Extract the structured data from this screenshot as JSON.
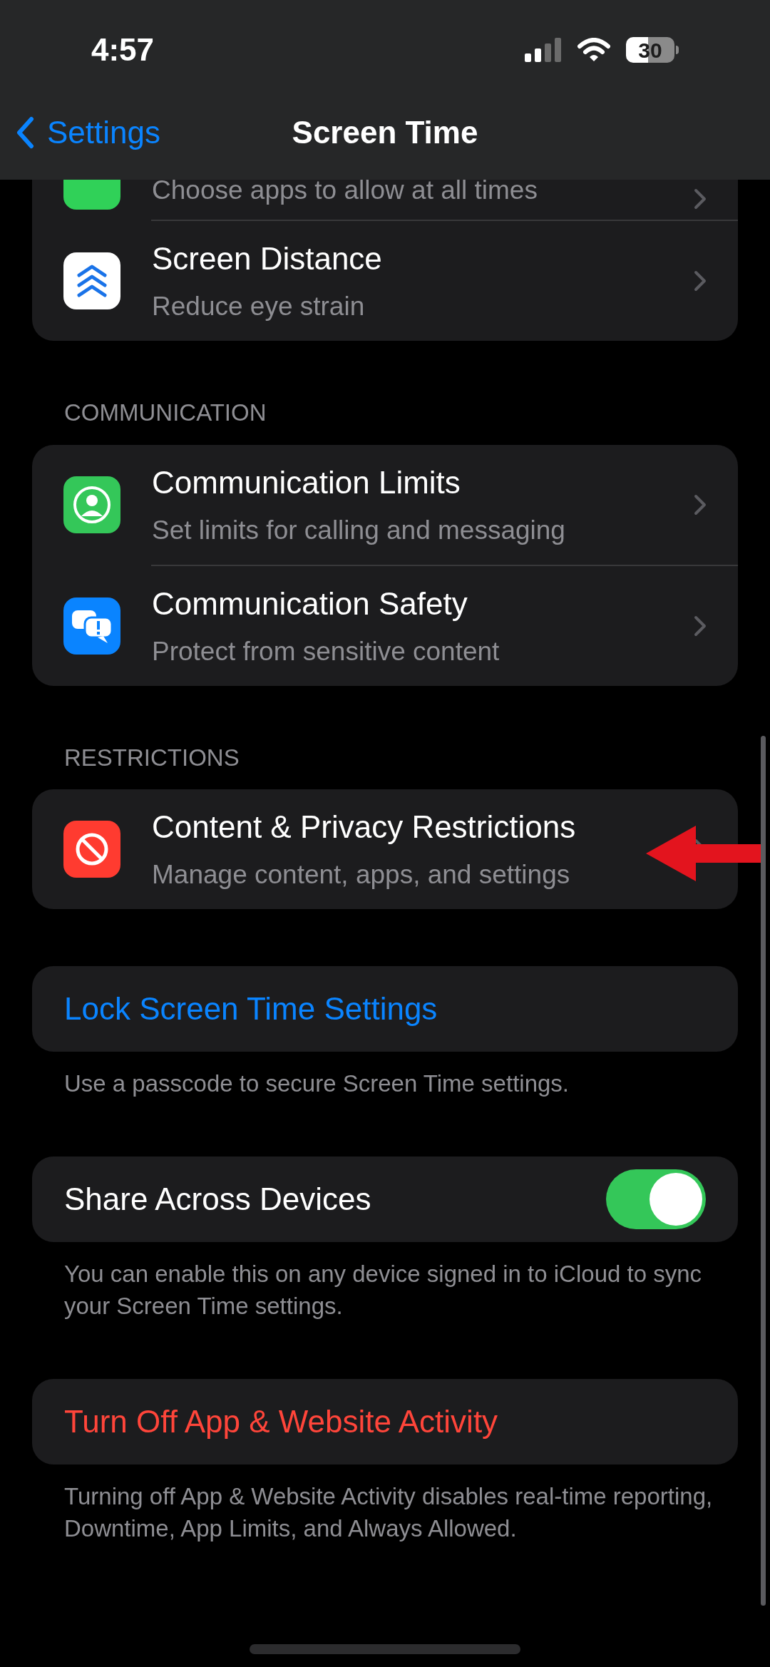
{
  "status_bar": {
    "time": "4:57",
    "battery": "30"
  },
  "nav": {
    "back": "Settings",
    "title": "Screen Time"
  },
  "sections": [
    {
      "rows": [
        {
          "kind": "nav",
          "subtitle": "Choose apps to allow at all times"
        },
        {
          "kind": "nav",
          "title": "Screen Distance",
          "subtitle": "Reduce eye strain"
        }
      ]
    },
    {
      "header": "COMMUNICATION",
      "rows": [
        {
          "kind": "nav",
          "title": "Communication Limits",
          "subtitle": "Set limits for calling and messaging"
        },
        {
          "kind": "nav",
          "title": "Communication Safety",
          "subtitle": "Protect from sensitive content"
        }
      ]
    },
    {
      "header": "RESTRICTIONS",
      "rows": [
        {
          "kind": "nav",
          "title": "Content & Privacy Restrictions",
          "subtitle": "Manage content, apps, and settings",
          "pointer": true
        }
      ]
    },
    {
      "rows": [
        {
          "kind": "link",
          "title": "Lock Screen Time Settings"
        }
      ],
      "footer": "Use a passcode to secure Screen Time settings."
    },
    {
      "rows": [
        {
          "kind": "toggle",
          "title": "Share Across Devices",
          "on": true
        }
      ],
      "footer": "You can enable this on any device signed in to iCloud to sync your Screen Time settings."
    },
    {
      "rows": [
        {
          "kind": "destructive",
          "title": "Turn Off App & Website Activity"
        }
      ],
      "footer": "Turning off App & Website Activity disables real-time reporting, Downtime, App Limits, and Always Allowed."
    }
  ]
}
